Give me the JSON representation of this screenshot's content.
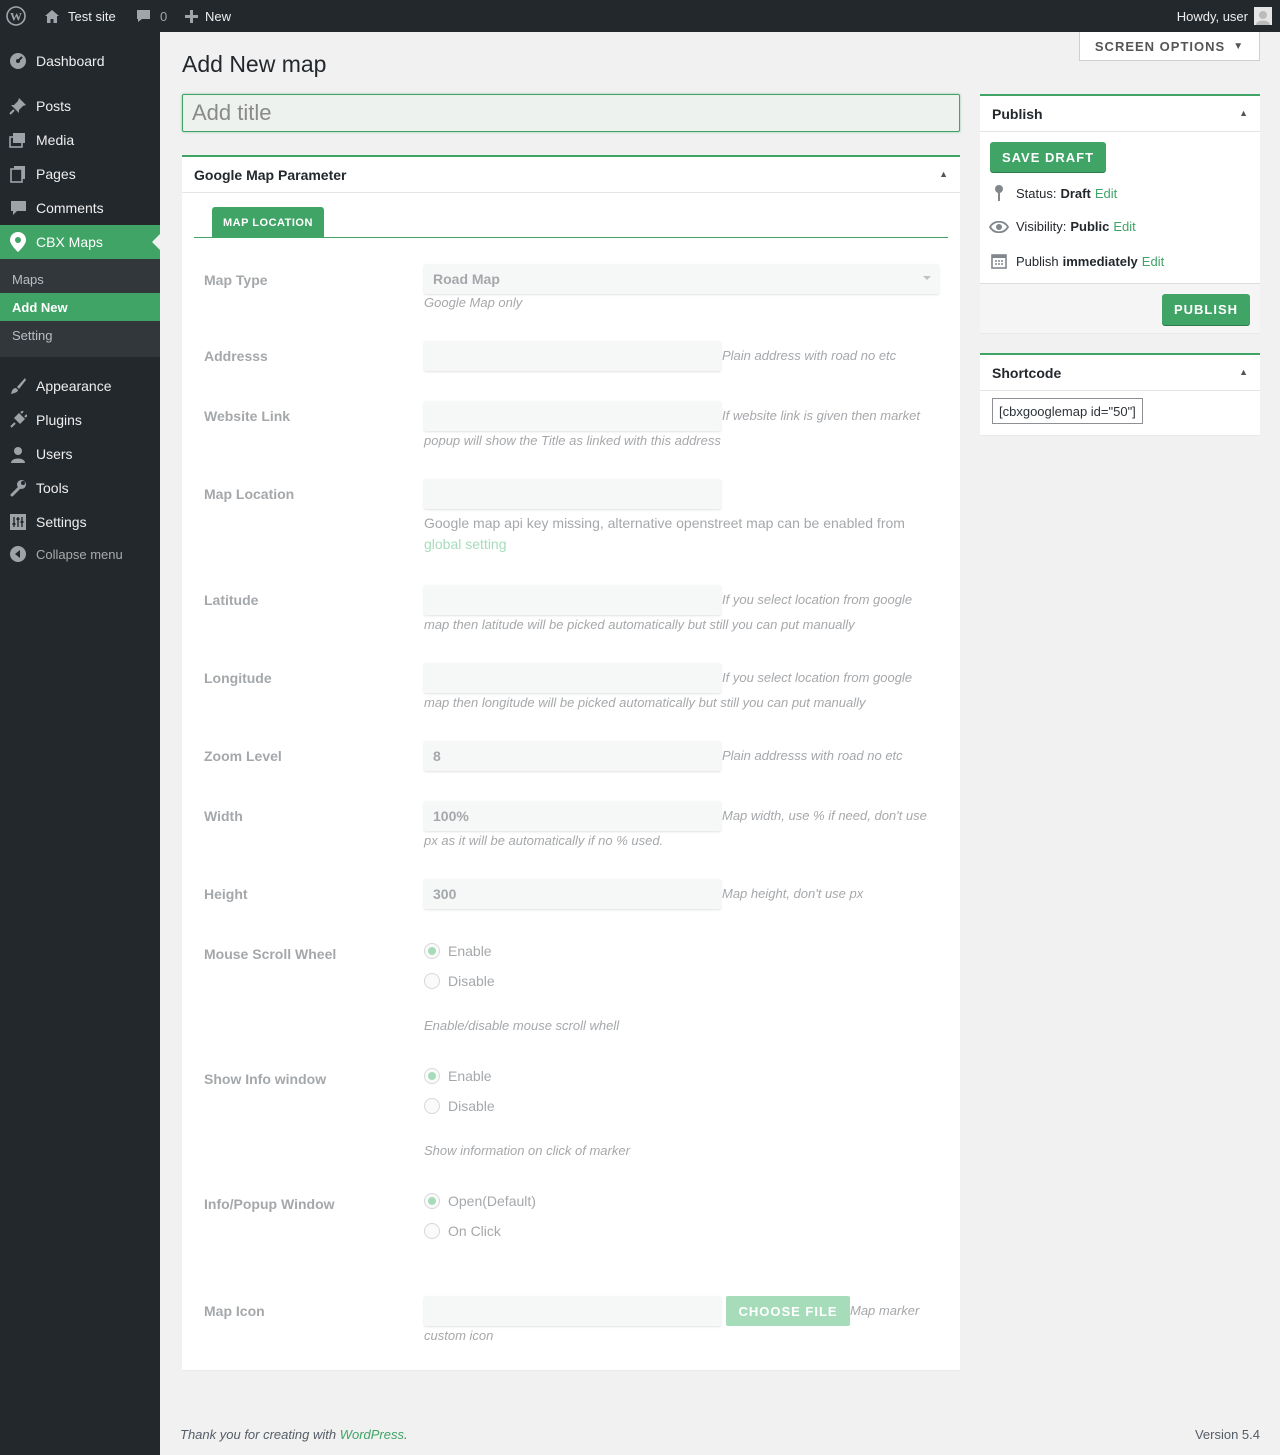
{
  "adminbar": {
    "site_name": "Test site",
    "comments_count": "0",
    "new_label": "New",
    "howdy": "Howdy, user"
  },
  "sidebar": {
    "items": [
      {
        "label": "Dashboard",
        "icon": "dashboard-icon"
      },
      {
        "label": "Posts",
        "icon": "pin-icon"
      },
      {
        "label": "Media",
        "icon": "media-icon"
      },
      {
        "label": "Pages",
        "icon": "pages-icon"
      },
      {
        "label": "Comments",
        "icon": "comment-icon"
      },
      {
        "label": "CBX Maps",
        "icon": "location-icon"
      },
      {
        "label": "Appearance",
        "icon": "brush-icon"
      },
      {
        "label": "Plugins",
        "icon": "plugin-icon"
      },
      {
        "label": "Users",
        "icon": "user-icon"
      },
      {
        "label": "Tools",
        "icon": "wrench-icon"
      },
      {
        "label": "Settings",
        "icon": "sliders-icon"
      }
    ],
    "submenu": [
      "Maps",
      "Add New",
      "Setting"
    ],
    "collapse_label": "Collapse menu"
  },
  "screen_options": "SCREEN OPTIONS",
  "page_title": "Add New map",
  "title_placeholder": "Add title",
  "gmap_box": {
    "heading": "Google Map Parameter",
    "tab": "MAP LOCATION",
    "fields": {
      "map_type": {
        "label": "Map Type",
        "value": "Road Map",
        "desc": "Google Map only"
      },
      "address": {
        "label": "Addresss",
        "value": "",
        "desc": "Plain address with road no etc"
      },
      "website_link": {
        "label": "Website Link",
        "value": "",
        "desc_a": "If website link is given then market",
        "desc_b": "popup will show the Title as linked with this address"
      },
      "map_location": {
        "label": "Map Location",
        "value": "",
        "desc": "Google map api key missing, alternative openstreet map can be enabled from",
        "link": "global setting"
      },
      "latitude": {
        "label": "Latitude",
        "value": "",
        "desc_a": "If you select location from google",
        "desc_b": "map then latitude will be picked automatically but still you can put manually"
      },
      "longitude": {
        "label": "Longitude",
        "value": "",
        "desc_a": "If you select location from google",
        "desc_b": "map then longitude will be picked automatically but still you can put manually"
      },
      "zoom": {
        "label": "Zoom Level",
        "value": "8",
        "desc": "Plain addresss with road no etc"
      },
      "width": {
        "label": "Width",
        "value": "100%",
        "desc_a": "Map width, use % if need, don't use",
        "desc_b": "px as it will be automatically if no % used."
      },
      "height": {
        "label": "Height",
        "value": "300",
        "desc": "Map height, don't use px"
      },
      "scroll": {
        "label": "Mouse Scroll Wheel",
        "opt1": "Enable",
        "opt2": "Disable",
        "selected": "Enable",
        "desc": "Enable/disable mouse scroll whell"
      },
      "info": {
        "label": "Show Info window",
        "opt1": "Enable",
        "opt2": "Disable",
        "selected": "Enable",
        "desc": "Show information on click of marker"
      },
      "popup": {
        "label": "Info/Popup Window",
        "opt1": "Open(Default)",
        "opt2": "On Click",
        "selected": "Open(Default)"
      },
      "icon": {
        "label": "Map Icon",
        "value": "",
        "button": "CHOOSE FILE",
        "desc_a": "Map marker",
        "desc_b": "custom icon"
      }
    }
  },
  "publish": {
    "heading": "Publish",
    "save_draft": "SAVE DRAFT",
    "status_label": "Status:",
    "status_value": "Draft",
    "visibility_label": "Visibility:",
    "visibility_value": "Public",
    "publish_label": "Publish",
    "publish_value": "immediately",
    "edit": "Edit",
    "publish_button": "PUBLISH"
  },
  "shortcode": {
    "heading": "Shortcode",
    "value": "[cbxgooglemap id=\"50\"]"
  },
  "footer": {
    "thanks_prefix": "Thank you for creating with ",
    "thanks_link": "WordPress",
    "thanks_suffix": ".",
    "version": "Version 5.4"
  },
  "colors": {
    "accent": "#3fa466",
    "adminbar": "#23282d",
    "submenu_bg": "#32373c"
  }
}
